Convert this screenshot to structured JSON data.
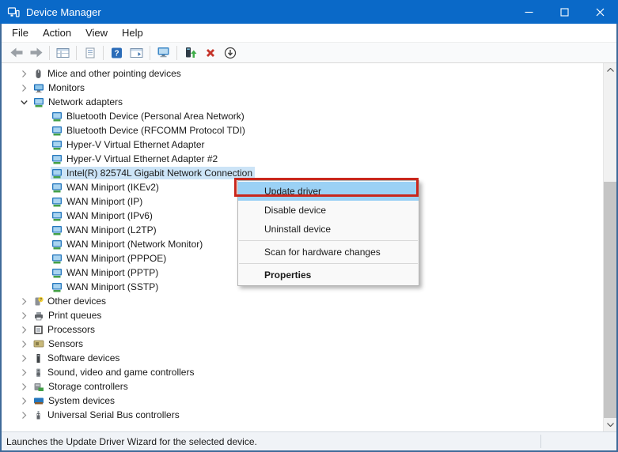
{
  "window": {
    "title": "Device Manager",
    "controls": [
      {
        "name": "minimize-button",
        "icon": "minimize-icon"
      },
      {
        "name": "maximize-button",
        "icon": "maximize-icon"
      },
      {
        "name": "close-button",
        "icon": "close-icon"
      }
    ]
  },
  "menu_bar": {
    "items": [
      "File",
      "Action",
      "View",
      "Help"
    ]
  },
  "toolbar": {
    "items": [
      "back-icon",
      "forward-icon",
      "|",
      "console-tree-icon",
      "|",
      "properties-list-icon",
      "|",
      "help-icon",
      "action-pane-icon",
      "|",
      "remote-computer-icon",
      "|",
      "update-driver-icon",
      "uninstall-device-icon",
      "scan-hardware-icon"
    ]
  },
  "tree": {
    "items": [
      {
        "label": "Mice and other pointing devices",
        "level": 0,
        "state": "collapsed",
        "icon": "mouse-icon"
      },
      {
        "label": "Monitors",
        "level": 0,
        "state": "collapsed",
        "icon": "monitor-icon"
      },
      {
        "label": "Network adapters",
        "level": 0,
        "state": "expanded",
        "icon": "network-adapter-icon"
      },
      {
        "label": "Bluetooth Device (Personal Area Network)",
        "level": 1,
        "icon": "network-adapter-icon"
      },
      {
        "label": "Bluetooth Device (RFCOMM Protocol TDI)",
        "level": 1,
        "icon": "network-adapter-icon"
      },
      {
        "label": "Hyper-V Virtual Ethernet Adapter",
        "level": 1,
        "icon": "network-adapter-icon"
      },
      {
        "label": "Hyper-V Virtual Ethernet Adapter #2",
        "level": 1,
        "icon": "network-adapter-icon"
      },
      {
        "label": "Intel(R) 82574L Gigabit Network Connection",
        "level": 1,
        "icon": "network-adapter-icon",
        "selected": true
      },
      {
        "label": "WAN Miniport (IKEv2)",
        "level": 1,
        "icon": "network-adapter-icon"
      },
      {
        "label": "WAN Miniport (IP)",
        "level": 1,
        "icon": "network-adapter-icon"
      },
      {
        "label": "WAN Miniport (IPv6)",
        "level": 1,
        "icon": "network-adapter-icon"
      },
      {
        "label": "WAN Miniport (L2TP)",
        "level": 1,
        "icon": "network-adapter-icon"
      },
      {
        "label": "WAN Miniport (Network Monitor)",
        "level": 1,
        "icon": "network-adapter-icon"
      },
      {
        "label": "WAN Miniport (PPPOE)",
        "level": 1,
        "icon": "network-adapter-icon"
      },
      {
        "label": "WAN Miniport (PPTP)",
        "level": 1,
        "icon": "network-adapter-icon"
      },
      {
        "label": "WAN Miniport (SSTP)",
        "level": 1,
        "icon": "network-adapter-icon"
      },
      {
        "label": "Other devices",
        "level": 0,
        "state": "collapsed",
        "icon": "unknown-device-icon"
      },
      {
        "label": "Print queues",
        "level": 0,
        "state": "collapsed",
        "icon": "printer-icon"
      },
      {
        "label": "Processors",
        "level": 0,
        "state": "collapsed",
        "icon": "processor-icon"
      },
      {
        "label": "Sensors",
        "level": 0,
        "state": "collapsed",
        "icon": "sensor-icon"
      },
      {
        "label": "Software devices",
        "level": 0,
        "state": "collapsed",
        "icon": "software-device-icon"
      },
      {
        "label": "Sound, video and game controllers",
        "level": 0,
        "state": "collapsed",
        "icon": "sound-icon"
      },
      {
        "label": "Storage controllers",
        "level": 0,
        "state": "collapsed",
        "icon": "storage-controller-icon"
      },
      {
        "label": "System devices",
        "level": 0,
        "state": "collapsed",
        "icon": "system-device-icon"
      },
      {
        "label": "Universal Serial Bus controllers",
        "level": 0,
        "state": "collapsed",
        "icon": "usb-icon"
      }
    ]
  },
  "context_menu": {
    "items": [
      {
        "label": "Update driver",
        "highlighted": true,
        "annotated": true
      },
      {
        "label": "Disable device"
      },
      {
        "label": "Uninstall device"
      },
      {
        "type": "separator"
      },
      {
        "label": "Scan for hardware changes"
      },
      {
        "type": "separator"
      },
      {
        "label": "Properties",
        "bold": true
      }
    ]
  },
  "status_bar": {
    "text": "Launches the Update Driver Wizard for the selected device."
  },
  "colors": {
    "titlebar": "#0a69c8",
    "annotation_red": "#c9271c",
    "menu_highlight": "#9bd1f5",
    "tree_selection": "#cce4f7",
    "frame_border": "#3f6a99"
  }
}
